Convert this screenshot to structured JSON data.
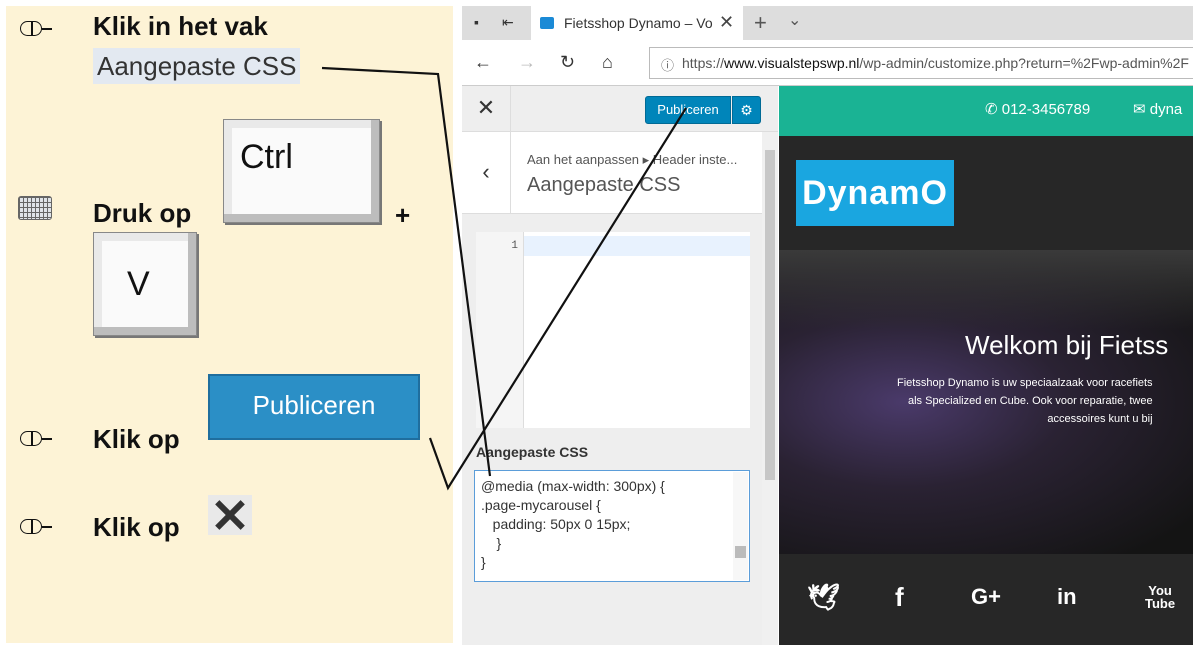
{
  "instructions": {
    "step1_line1": "Klik in het vak",
    "step1_field": "Aangepaste CSS",
    "step2_text": "Druk op",
    "step2_key1": "Ctrl",
    "step2_plus": "+",
    "step2_key2": "V",
    "step3_text": "Klik op",
    "step3_button": "Publiceren",
    "step4_text": "Klik op"
  },
  "browser": {
    "tab_title": "Fietsshop Dynamo – Vo",
    "tab_close": "✕",
    "new_tab": "+",
    "tab_menu": "⌄",
    "url_prefix": "https://",
    "url_domain": "www.visualstepswp.nl",
    "url_rest": "/wp-admin/customize.php?return=%2Fwp-admin%2F"
  },
  "customizer": {
    "close": "✕",
    "publish_label": "Publiceren",
    "back": "‹",
    "breadcrumb": "Aan het aanpassen ▸ Header inste...",
    "panel_title": "Aangepaste CSS",
    "line_number": "1",
    "css_label": "Aangepaste CSS",
    "css_code": "@media (max-width: 300px) {\n.page-mycarousel {\n   padding: 50px 0 15px;\n    }\n}"
  },
  "preview": {
    "phone": "012-3456789",
    "mail": "dyna",
    "logo": "DynamO",
    "hero_title": "Welkom bij Fietss",
    "hero_subtitle": "Fietsshop Dynamo is uw speciaalzaak voor racefiets\nals Specialized en Cube. Ook voor reparatie, twee\naccessoires kunt u bij",
    "social": [
      "twitter",
      "facebook",
      "google-plus",
      "linkedin",
      "youtube"
    ]
  },
  "colors": {
    "instructions_bg": "#fdf3d6",
    "wp_blue": "#0085ba",
    "teal": "#1ab394",
    "logo_blue": "#1aa6e0"
  }
}
